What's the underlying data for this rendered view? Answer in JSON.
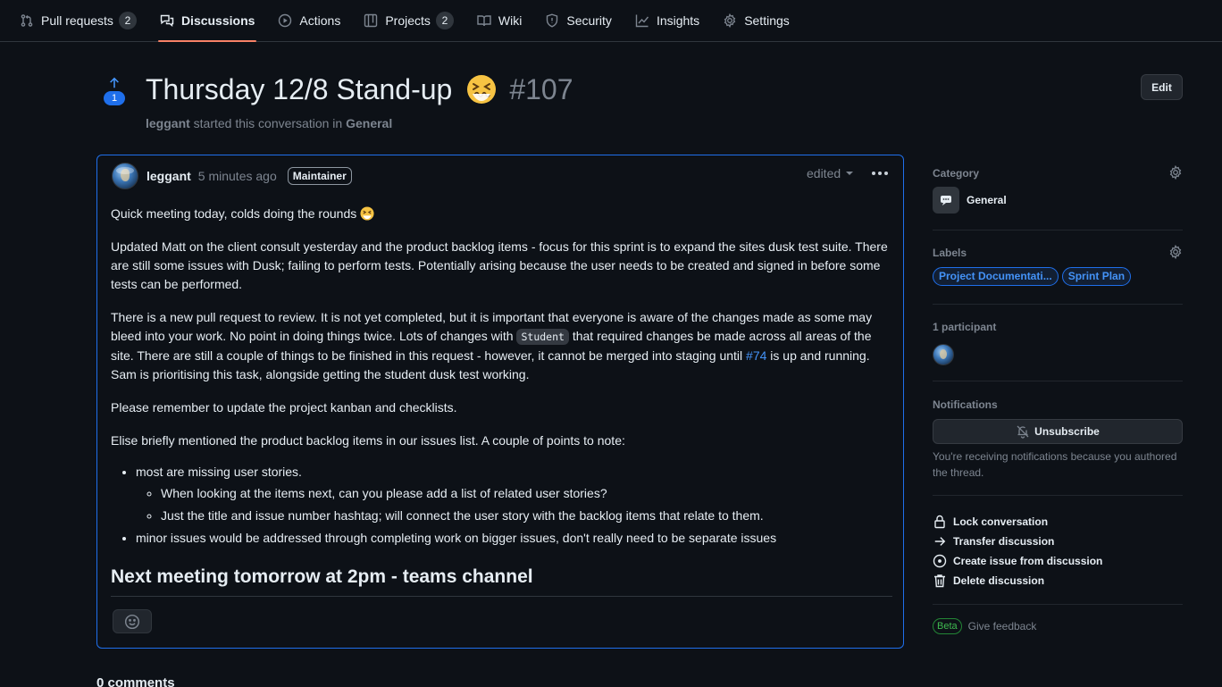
{
  "tabs": [
    {
      "label": "Pull requests",
      "icon": "git-pull-request-icon",
      "counter": "2"
    },
    {
      "label": "Discussions",
      "icon": "comment-discussion-icon",
      "counter": null,
      "selected": true
    },
    {
      "label": "Actions",
      "icon": "play-icon",
      "counter": null
    },
    {
      "label": "Projects",
      "icon": "table-icon",
      "counter": "2"
    },
    {
      "label": "Wiki",
      "icon": "book-icon",
      "counter": null
    },
    {
      "label": "Security",
      "icon": "shield-icon",
      "counter": null
    },
    {
      "label": "Insights",
      "icon": "graph-icon",
      "counter": null
    },
    {
      "label": "Settings",
      "icon": "gear-icon",
      "counter": null
    }
  ],
  "header": {
    "upvotes": "1",
    "title": "Thursday 12/8 Stand-up",
    "number": "#107",
    "author": "leggant",
    "started_text": "started this conversation in",
    "category": "General",
    "edit_label": "Edit"
  },
  "post": {
    "author": "leggant",
    "time": "5 minutes ago",
    "role": "Maintainer",
    "edited_label": "edited",
    "p1": "Quick meeting today, colds doing the rounds",
    "p2": "Updated Matt on the client consult yesterday and the product backlog items - focus for this sprint is to expand the sites dusk test suite. There are still some issues with Dusk; failing to perform tests. Potentially arising because the user needs to be created and signed in before some tests can be performed.",
    "p3_a": "There is a new pull request to review. It is not yet completed, but it is important that everyone is aware of the changes made as some may bleed into your work. No point in doing things twice. Lots of changes with ",
    "p3_code": "Student",
    "p3_b": " that required changes be made across all areas of the site. There are still a couple of things to be finished in this request - however, it cannot be merged into staging until ",
    "p3_link": "#74",
    "p3_c": " is up and running. Sam is prioritising this task, alongside getting the student dusk test working.",
    "p4": "Please remember to update the project kanban and checklists.",
    "p5": "Elise briefly mentioned the product backlog items in our issues list. A couple of points to note:",
    "bullet1": "most are missing user stories.",
    "sub1": "When looking at the items next, can you please add a list of related user stories?",
    "sub2": "Just the title and issue number hashtag; will connect the user story with the backlog items that relate to them.",
    "bullet2": "minor issues would be addressed through completing work on bigger issues, don't really need to be separate issues",
    "heading": "Next meeting tomorrow at 2pm - teams channel"
  },
  "comments_count": "0 comments",
  "sidebar": {
    "category_heading": "Category",
    "category_name": "General",
    "labels_heading": "Labels",
    "labels": [
      "Project Documentati...",
      "Sprint Plan"
    ],
    "participants_heading": "1 participant",
    "notifications_heading": "Notifications",
    "unsubscribe_label": "Unsubscribe",
    "notifications_note": "You're receiving notifications because you authored the thread.",
    "actions": [
      {
        "label": "Lock conversation",
        "icon": "lock-icon"
      },
      {
        "label": "Transfer discussion",
        "icon": "arrow-right-icon"
      },
      {
        "label": "Create issue from discussion",
        "icon": "issue-opened-icon"
      },
      {
        "label": "Delete discussion",
        "icon": "trash-icon"
      }
    ],
    "beta_label": "Beta",
    "feedback_label": "Give feedback"
  }
}
